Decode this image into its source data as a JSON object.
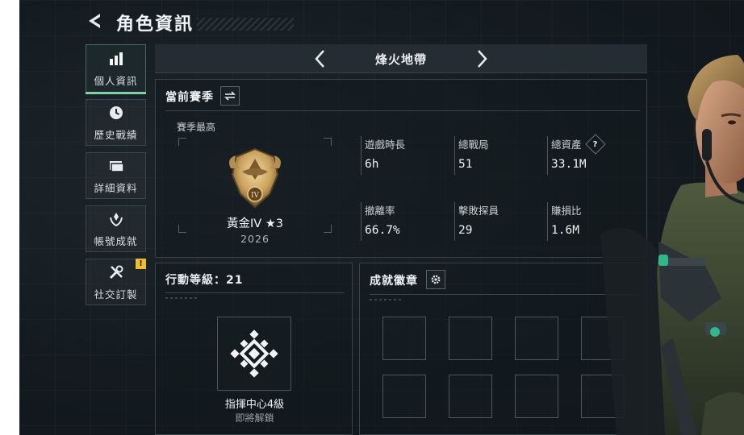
{
  "header": {
    "title": "角色資訊"
  },
  "nav": {
    "items": [
      {
        "label": "個人資訊",
        "icon": "bar-chart-icon",
        "active": true
      },
      {
        "label": "歷史戰績",
        "icon": "clock-icon"
      },
      {
        "label": "詳細資料",
        "icon": "folder-icon"
      },
      {
        "label": "帳號成就",
        "icon": "laurel-icon"
      },
      {
        "label": "社交訂製",
        "icon": "tools-icon",
        "badge": "!"
      }
    ]
  },
  "map_bar": {
    "name": "烽火地帶"
  },
  "season": {
    "title": "當前賽季",
    "subtitle": "賽季最高",
    "rank": {
      "name": "黃金IV ★3",
      "year": "2026",
      "tier_mark": "IV"
    },
    "stats": [
      {
        "label": "遊戲時長",
        "value": "6h"
      },
      {
        "label": "總戰局",
        "value": "51"
      },
      {
        "label": "總資產",
        "value": "33.1M",
        "help": "?"
      },
      {
        "label": "撤離率",
        "value": "66.7%"
      },
      {
        "label": "擊敗探員",
        "value": "29"
      },
      {
        "label": "賺損比",
        "value": "1.6M"
      }
    ]
  },
  "level": {
    "title": "行動等級：21",
    "item_name": "指揮中心4級",
    "note": "即將解鎖"
  },
  "achievements": {
    "title": "成就徽章",
    "slots": 8
  },
  "colors": {
    "accent": "#7ed0a8",
    "badge": "#f0c020",
    "gold": "#c9a15c"
  }
}
